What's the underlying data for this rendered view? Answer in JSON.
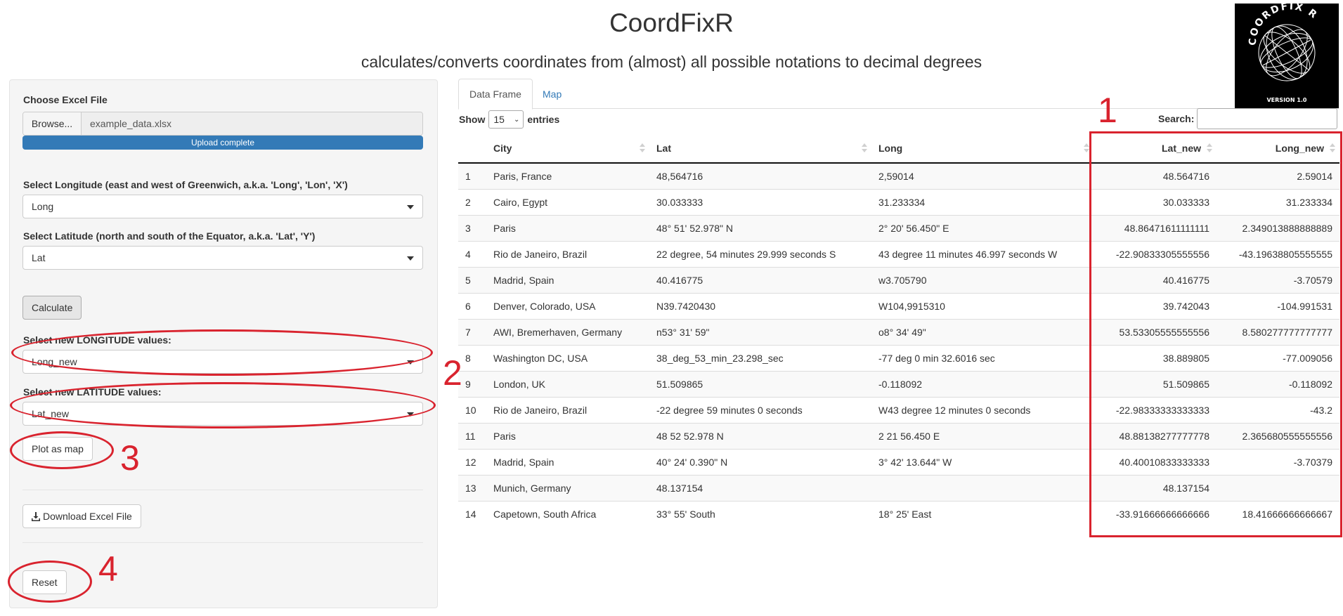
{
  "header": {
    "title": "CoordFixR",
    "subtitle": "calculates/converts coordinates from (almost) all possible notations to decimal degrees",
    "logo_text": "COORDFIX R",
    "logo_version": "VERSION 1.0"
  },
  "sidebar": {
    "file_label": "Choose Excel File",
    "browse_label": "Browse...",
    "file_name": "example_data.xlsx",
    "upload_status": "Upload complete",
    "upload_progress": 1.0,
    "longitude_label": "Select Longitude (east and west of Greenwich, a.k.a. 'Long', 'Lon', 'X')",
    "longitude_value": "Long",
    "latitude_label": "Select Latitude (north and south of the Equator, a.k.a. 'Lat', 'Y')",
    "latitude_value": "Lat",
    "calculate_label": "Calculate",
    "new_longitude_label": "Select new LONGITUDE values:",
    "new_longitude_value": "Long_new",
    "new_latitude_label": "Select new LATITUDE values:",
    "new_latitude_value": "Lat_new",
    "plot_label": "Plot as map",
    "download_label": "Download Excel File",
    "reset_label": "Reset"
  },
  "tabs": [
    {
      "label": "Data Frame",
      "active": true
    },
    {
      "label": "Map",
      "active": false
    }
  ],
  "table_controls": {
    "show_label": "Show",
    "entries_value": "15",
    "entries_label": "entries",
    "search_label": "Search:"
  },
  "table": {
    "columns": [
      "",
      "City",
      "Lat",
      "Long",
      "Lat_new",
      "Long_new"
    ],
    "rows": [
      [
        "1",
        "Paris, France",
        "48,564716",
        "2,59014",
        "48.564716",
        "2.59014"
      ],
      [
        "2",
        "Cairo, Egypt",
        "30.033333",
        "31.233334",
        "30.033333",
        "31.233334"
      ],
      [
        "3",
        "Paris",
        "48° 51' 52.978\" N",
        "2° 20' 56.450\" E",
        "48.86471611111111",
        "2.349013888888889"
      ],
      [
        "4",
        "Rio de Janeiro, Brazil",
        "22 degree, 54 minutes 29.999 seconds S",
        "43 degree 11 minutes 46.997 seconds W",
        "-22.90833305555556",
        "-43.19638805555555"
      ],
      [
        "5",
        "Madrid, Spain",
        "40.416775",
        "w3.705790",
        "40.416775",
        "-3.70579"
      ],
      [
        "6",
        "Denver, Colorado, USA",
        "N39.7420430",
        "W104,9915310",
        "39.742043",
        "-104.991531"
      ],
      [
        "7",
        "AWI, Bremerhaven, Germany",
        "n53° 31' 59\"",
        "o8° 34' 49\"",
        "53.53305555555556",
        "8.580277777777777"
      ],
      [
        "8",
        "Washington DC, USA",
        "38_deg_53_min_23.298_sec",
        "-77 deg 0 min 32.6016 sec",
        "38.889805",
        "-77.009056"
      ],
      [
        "9",
        "London, UK",
        "51.509865",
        "-0.118092",
        "51.509865",
        "-0.118092"
      ],
      [
        "10",
        "Rio de Janeiro, Brazil",
        "-22 degree 59 minutes 0 seconds",
        "W43 degree 12 minutes 0 seconds",
        "-22.98333333333333",
        "-43.2"
      ],
      [
        "11",
        "Paris",
        "48 52 52.978 N",
        "2 21 56.450 E",
        "48.88138277777778",
        "2.365680555555556"
      ],
      [
        "12",
        "Madrid, Spain",
        "40° 24' 0.390\" N",
        "3° 42' 13.644\" W",
        "40.40010833333333",
        "-3.70379"
      ],
      [
        "13",
        "Munich, Germany",
        "48.137154",
        "",
        "48.137154",
        ""
      ],
      [
        "14",
        "Capetown, South Africa",
        "33° 55' South",
        "18° 25' East",
        "-33.91666666666666",
        "18.41666666666667"
      ]
    ]
  },
  "annotations": {
    "one": "1",
    "two": "2",
    "three": "3",
    "four": "4",
    "color": "#d9232e"
  },
  "colors": {
    "primary": "#337ab7",
    "annotation": "#d9232e"
  }
}
